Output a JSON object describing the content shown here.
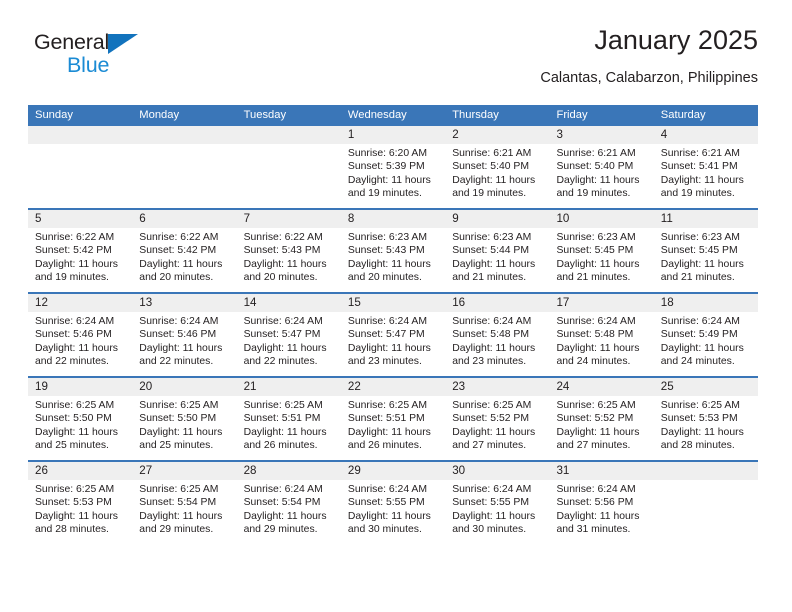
{
  "brand": {
    "name_part1": "General",
    "name_part2": "Blue",
    "triangle_icon": "triangle-icon",
    "accent_dark": "#231f20",
    "accent_blue": "#1b8bd4",
    "logo_triangle_blue": "#1273bd"
  },
  "header": {
    "title": "January 2025",
    "subtitle": "Calantas, Calabarzon, Philippines"
  },
  "theme": {
    "header_row_blue": "#3a76b8",
    "daynum_band": "#efefef",
    "text": "#231f20"
  },
  "calendar": {
    "weekday_headers": [
      "Sunday",
      "Monday",
      "Tuesday",
      "Wednesday",
      "Thursday",
      "Friday",
      "Saturday"
    ],
    "weeks": [
      [
        {
          "day": "",
          "sunrise": "",
          "sunset": "",
          "daylight": ""
        },
        {
          "day": "",
          "sunrise": "",
          "sunset": "",
          "daylight": ""
        },
        {
          "day": "",
          "sunrise": "",
          "sunset": "",
          "daylight": ""
        },
        {
          "day": "1",
          "sunrise": "Sunrise: 6:20 AM",
          "sunset": "Sunset: 5:39 PM",
          "daylight": "Daylight: 11 hours and 19 minutes."
        },
        {
          "day": "2",
          "sunrise": "Sunrise: 6:21 AM",
          "sunset": "Sunset: 5:40 PM",
          "daylight": "Daylight: 11 hours and 19 minutes."
        },
        {
          "day": "3",
          "sunrise": "Sunrise: 6:21 AM",
          "sunset": "Sunset: 5:40 PM",
          "daylight": "Daylight: 11 hours and 19 minutes."
        },
        {
          "day": "4",
          "sunrise": "Sunrise: 6:21 AM",
          "sunset": "Sunset: 5:41 PM",
          "daylight": "Daylight: 11 hours and 19 minutes."
        }
      ],
      [
        {
          "day": "5",
          "sunrise": "Sunrise: 6:22 AM",
          "sunset": "Sunset: 5:42 PM",
          "daylight": "Daylight: 11 hours and 19 minutes."
        },
        {
          "day": "6",
          "sunrise": "Sunrise: 6:22 AM",
          "sunset": "Sunset: 5:42 PM",
          "daylight": "Daylight: 11 hours and 20 minutes."
        },
        {
          "day": "7",
          "sunrise": "Sunrise: 6:22 AM",
          "sunset": "Sunset: 5:43 PM",
          "daylight": "Daylight: 11 hours and 20 minutes."
        },
        {
          "day": "8",
          "sunrise": "Sunrise: 6:23 AM",
          "sunset": "Sunset: 5:43 PM",
          "daylight": "Daylight: 11 hours and 20 minutes."
        },
        {
          "day": "9",
          "sunrise": "Sunrise: 6:23 AM",
          "sunset": "Sunset: 5:44 PM",
          "daylight": "Daylight: 11 hours and 21 minutes."
        },
        {
          "day": "10",
          "sunrise": "Sunrise: 6:23 AM",
          "sunset": "Sunset: 5:45 PM",
          "daylight": "Daylight: 11 hours and 21 minutes."
        },
        {
          "day": "11",
          "sunrise": "Sunrise: 6:23 AM",
          "sunset": "Sunset: 5:45 PM",
          "daylight": "Daylight: 11 hours and 21 minutes."
        }
      ],
      [
        {
          "day": "12",
          "sunrise": "Sunrise: 6:24 AM",
          "sunset": "Sunset: 5:46 PM",
          "daylight": "Daylight: 11 hours and 22 minutes."
        },
        {
          "day": "13",
          "sunrise": "Sunrise: 6:24 AM",
          "sunset": "Sunset: 5:46 PM",
          "daylight": "Daylight: 11 hours and 22 minutes."
        },
        {
          "day": "14",
          "sunrise": "Sunrise: 6:24 AM",
          "sunset": "Sunset: 5:47 PM",
          "daylight": "Daylight: 11 hours and 22 minutes."
        },
        {
          "day": "15",
          "sunrise": "Sunrise: 6:24 AM",
          "sunset": "Sunset: 5:47 PM",
          "daylight": "Daylight: 11 hours and 23 minutes."
        },
        {
          "day": "16",
          "sunrise": "Sunrise: 6:24 AM",
          "sunset": "Sunset: 5:48 PM",
          "daylight": "Daylight: 11 hours and 23 minutes."
        },
        {
          "day": "17",
          "sunrise": "Sunrise: 6:24 AM",
          "sunset": "Sunset: 5:48 PM",
          "daylight": "Daylight: 11 hours and 24 minutes."
        },
        {
          "day": "18",
          "sunrise": "Sunrise: 6:24 AM",
          "sunset": "Sunset: 5:49 PM",
          "daylight": "Daylight: 11 hours and 24 minutes."
        }
      ],
      [
        {
          "day": "19",
          "sunrise": "Sunrise: 6:25 AM",
          "sunset": "Sunset: 5:50 PM",
          "daylight": "Daylight: 11 hours and 25 minutes."
        },
        {
          "day": "20",
          "sunrise": "Sunrise: 6:25 AM",
          "sunset": "Sunset: 5:50 PM",
          "daylight": "Daylight: 11 hours and 25 minutes."
        },
        {
          "day": "21",
          "sunrise": "Sunrise: 6:25 AM",
          "sunset": "Sunset: 5:51 PM",
          "daylight": "Daylight: 11 hours and 26 minutes."
        },
        {
          "day": "22",
          "sunrise": "Sunrise: 6:25 AM",
          "sunset": "Sunset: 5:51 PM",
          "daylight": "Daylight: 11 hours and 26 minutes."
        },
        {
          "day": "23",
          "sunrise": "Sunrise: 6:25 AM",
          "sunset": "Sunset: 5:52 PM",
          "daylight": "Daylight: 11 hours and 27 minutes."
        },
        {
          "day": "24",
          "sunrise": "Sunrise: 6:25 AM",
          "sunset": "Sunset: 5:52 PM",
          "daylight": "Daylight: 11 hours and 27 minutes."
        },
        {
          "day": "25",
          "sunrise": "Sunrise: 6:25 AM",
          "sunset": "Sunset: 5:53 PM",
          "daylight": "Daylight: 11 hours and 28 minutes."
        }
      ],
      [
        {
          "day": "26",
          "sunrise": "Sunrise: 6:25 AM",
          "sunset": "Sunset: 5:53 PM",
          "daylight": "Daylight: 11 hours and 28 minutes."
        },
        {
          "day": "27",
          "sunrise": "Sunrise: 6:25 AM",
          "sunset": "Sunset: 5:54 PM",
          "daylight": "Daylight: 11 hours and 29 minutes."
        },
        {
          "day": "28",
          "sunrise": "Sunrise: 6:24 AM",
          "sunset": "Sunset: 5:54 PM",
          "daylight": "Daylight: 11 hours and 29 minutes."
        },
        {
          "day": "29",
          "sunrise": "Sunrise: 6:24 AM",
          "sunset": "Sunset: 5:55 PM",
          "daylight": "Daylight: 11 hours and 30 minutes."
        },
        {
          "day": "30",
          "sunrise": "Sunrise: 6:24 AM",
          "sunset": "Sunset: 5:55 PM",
          "daylight": "Daylight: 11 hours and 30 minutes."
        },
        {
          "day": "31",
          "sunrise": "Sunrise: 6:24 AM",
          "sunset": "Sunset: 5:56 PM",
          "daylight": "Daylight: 11 hours and 31 minutes."
        },
        {
          "day": "",
          "sunrise": "",
          "sunset": "",
          "daylight": ""
        }
      ]
    ]
  }
}
